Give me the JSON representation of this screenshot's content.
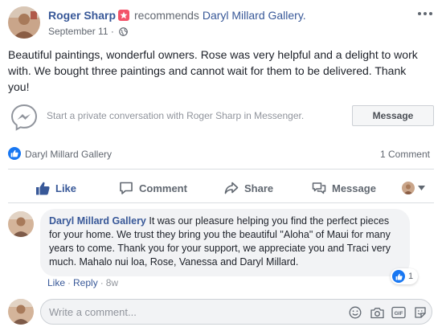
{
  "post": {
    "author": "Roger Sharp",
    "action_text": "recommends",
    "page_name": "Daryl Millard Gallery.",
    "date": "September 11",
    "meta_separator": "·",
    "body": "Beautiful paintings, wonderful owners. Rose was very helpful and a delight to work with. We bought three paintings and cannot wait for them to be delivered. Thank you!"
  },
  "messenger": {
    "prompt": "Start a private conversation with Roger Sharp in Messenger.",
    "button_label": "Message"
  },
  "stats": {
    "liked_by": "Daryl Millard Gallery",
    "comment_count": "1 Comment"
  },
  "actions": {
    "like": "Like",
    "comment": "Comment",
    "share": "Share",
    "message": "Message"
  },
  "comment": {
    "author": "Daryl Millard Gallery",
    "text": " It was our pleasure helping you find the perfect pieces for your home. We trust they bring you the beautiful \"Aloha\" of Maui for many years to come. Thank you for your support, we appreciate you and Traci very much. Mahalo nui loa, Rose, Vanessa and Daryl Millard.",
    "like_label": "Like",
    "separator": "·",
    "reply_label": "Reply",
    "time": "8w",
    "reaction_count": "1"
  },
  "composer": {
    "placeholder": "Write a comment...",
    "gif_label": "GIF"
  },
  "colors": {
    "link_blue": "#385898",
    "facebook_blue": "#1877f2",
    "badge_pink": "#f35369",
    "muted_gray": "#616770",
    "bubble_gray": "#f2f3f5"
  },
  "icons": [
    "recommend-star-icon",
    "globe-icon",
    "more-options-icon",
    "messenger-icon",
    "like-thumb-icon",
    "comment-icon",
    "share-icon",
    "message-icon",
    "audience-chevron-icon",
    "emoji-icon",
    "camera-icon",
    "gif-icon",
    "sticker-icon"
  ]
}
